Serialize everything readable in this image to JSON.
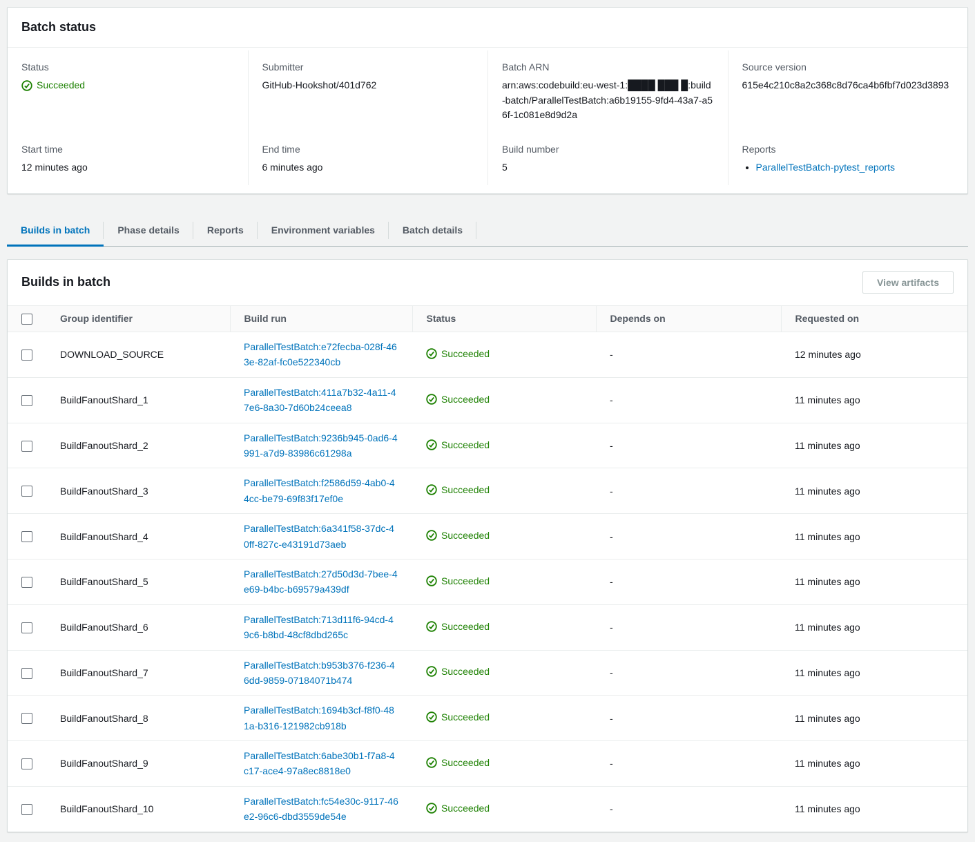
{
  "colors": {
    "link": "#0073bb",
    "success": "#1d8102",
    "active_tab": "#0073bb",
    "background": "#f2f3f3"
  },
  "icons": {
    "status_success": "check-circle-icon"
  },
  "batch_status": {
    "title": "Batch status",
    "status": {
      "label": "Status",
      "value": "Succeeded"
    },
    "submitter": {
      "label": "Submitter",
      "value": "GitHub-Hookshot/401d762"
    },
    "batch_arn": {
      "label": "Batch ARN",
      "value": "arn:aws:codebuild:eu-west-1:████ ███ █:build-batch/ParallelTestBatch:a6b19155-9fd4-43a7-a56f-1c081e8d9d2a"
    },
    "source_version": {
      "label": "Source version",
      "value": "615e4c210c8a2c368c8d76ca4b6fbf7d023d3893"
    },
    "start_time": {
      "label": "Start time",
      "value": "12 minutes ago"
    },
    "end_time": {
      "label": "End time",
      "value": "6 minutes ago"
    },
    "build_number": {
      "label": "Build number",
      "value": "5"
    },
    "reports": {
      "label": "Reports",
      "link": "ParallelTestBatch-pytest_reports"
    }
  },
  "tabs": [
    {
      "label": "Builds in batch",
      "active": true
    },
    {
      "label": "Phase details",
      "active": false
    },
    {
      "label": "Reports",
      "active": false
    },
    {
      "label": "Environment variables",
      "active": false
    },
    {
      "label": "Batch details",
      "active": false
    }
  ],
  "builds_table": {
    "title": "Builds in batch",
    "view_artifacts_label": "View artifacts",
    "columns": [
      "Group identifier",
      "Build run",
      "Status",
      "Depends on",
      "Requested on"
    ],
    "rows": [
      {
        "group_identifier": "DOWNLOAD_SOURCE",
        "build_run": "ParallelTestBatch:e72fecba-028f-463e-82af-fc0e522340cb",
        "status": "Succeeded",
        "depends_on": "-",
        "requested_on": "12 minutes ago"
      },
      {
        "group_identifier": "BuildFanoutShard_1",
        "build_run": "ParallelTestBatch:411a7b32-4a11-47e6-8a30-7d60b24ceea8",
        "status": "Succeeded",
        "depends_on": "-",
        "requested_on": "11 minutes ago"
      },
      {
        "group_identifier": "BuildFanoutShard_2",
        "build_run": "ParallelTestBatch:9236b945-0ad6-4991-a7d9-83986c61298a",
        "status": "Succeeded",
        "depends_on": "-",
        "requested_on": "11 minutes ago"
      },
      {
        "group_identifier": "BuildFanoutShard_3",
        "build_run": "ParallelTestBatch:f2586d59-4ab0-44cc-be79-69f83f17ef0e",
        "status": "Succeeded",
        "depends_on": "-",
        "requested_on": "11 minutes ago"
      },
      {
        "group_identifier": "BuildFanoutShard_4",
        "build_run": "ParallelTestBatch:6a341f58-37dc-40ff-827c-e43191d73aeb",
        "status": "Succeeded",
        "depends_on": "-",
        "requested_on": "11 minutes ago"
      },
      {
        "group_identifier": "BuildFanoutShard_5",
        "build_run": "ParallelTestBatch:27d50d3d-7bee-4e69-b4bc-b69579a439df",
        "status": "Succeeded",
        "depends_on": "-",
        "requested_on": "11 minutes ago"
      },
      {
        "group_identifier": "BuildFanoutShard_6",
        "build_run": "ParallelTestBatch:713d11f6-94cd-49c6-b8bd-48cf8dbd265c",
        "status": "Succeeded",
        "depends_on": "-",
        "requested_on": "11 minutes ago"
      },
      {
        "group_identifier": "BuildFanoutShard_7",
        "build_run": "ParallelTestBatch:b953b376-f236-46dd-9859-07184071b474",
        "status": "Succeeded",
        "depends_on": "-",
        "requested_on": "11 minutes ago"
      },
      {
        "group_identifier": "BuildFanoutShard_8",
        "build_run": "ParallelTestBatch:1694b3cf-f8f0-481a-b316-121982cb918b",
        "status": "Succeeded",
        "depends_on": "-",
        "requested_on": "11 minutes ago"
      },
      {
        "group_identifier": "BuildFanoutShard_9",
        "build_run": "ParallelTestBatch:6abe30b1-f7a8-4c17-ace4-97a8ec8818e0",
        "status": "Succeeded",
        "depends_on": "-",
        "requested_on": "11 minutes ago"
      },
      {
        "group_identifier": "BuildFanoutShard_10",
        "build_run": "ParallelTestBatch:fc54e30c-9117-46e2-96c6-dbd3559de54e",
        "status": "Succeeded",
        "depends_on": "-",
        "requested_on": "11 minutes ago"
      }
    ]
  }
}
